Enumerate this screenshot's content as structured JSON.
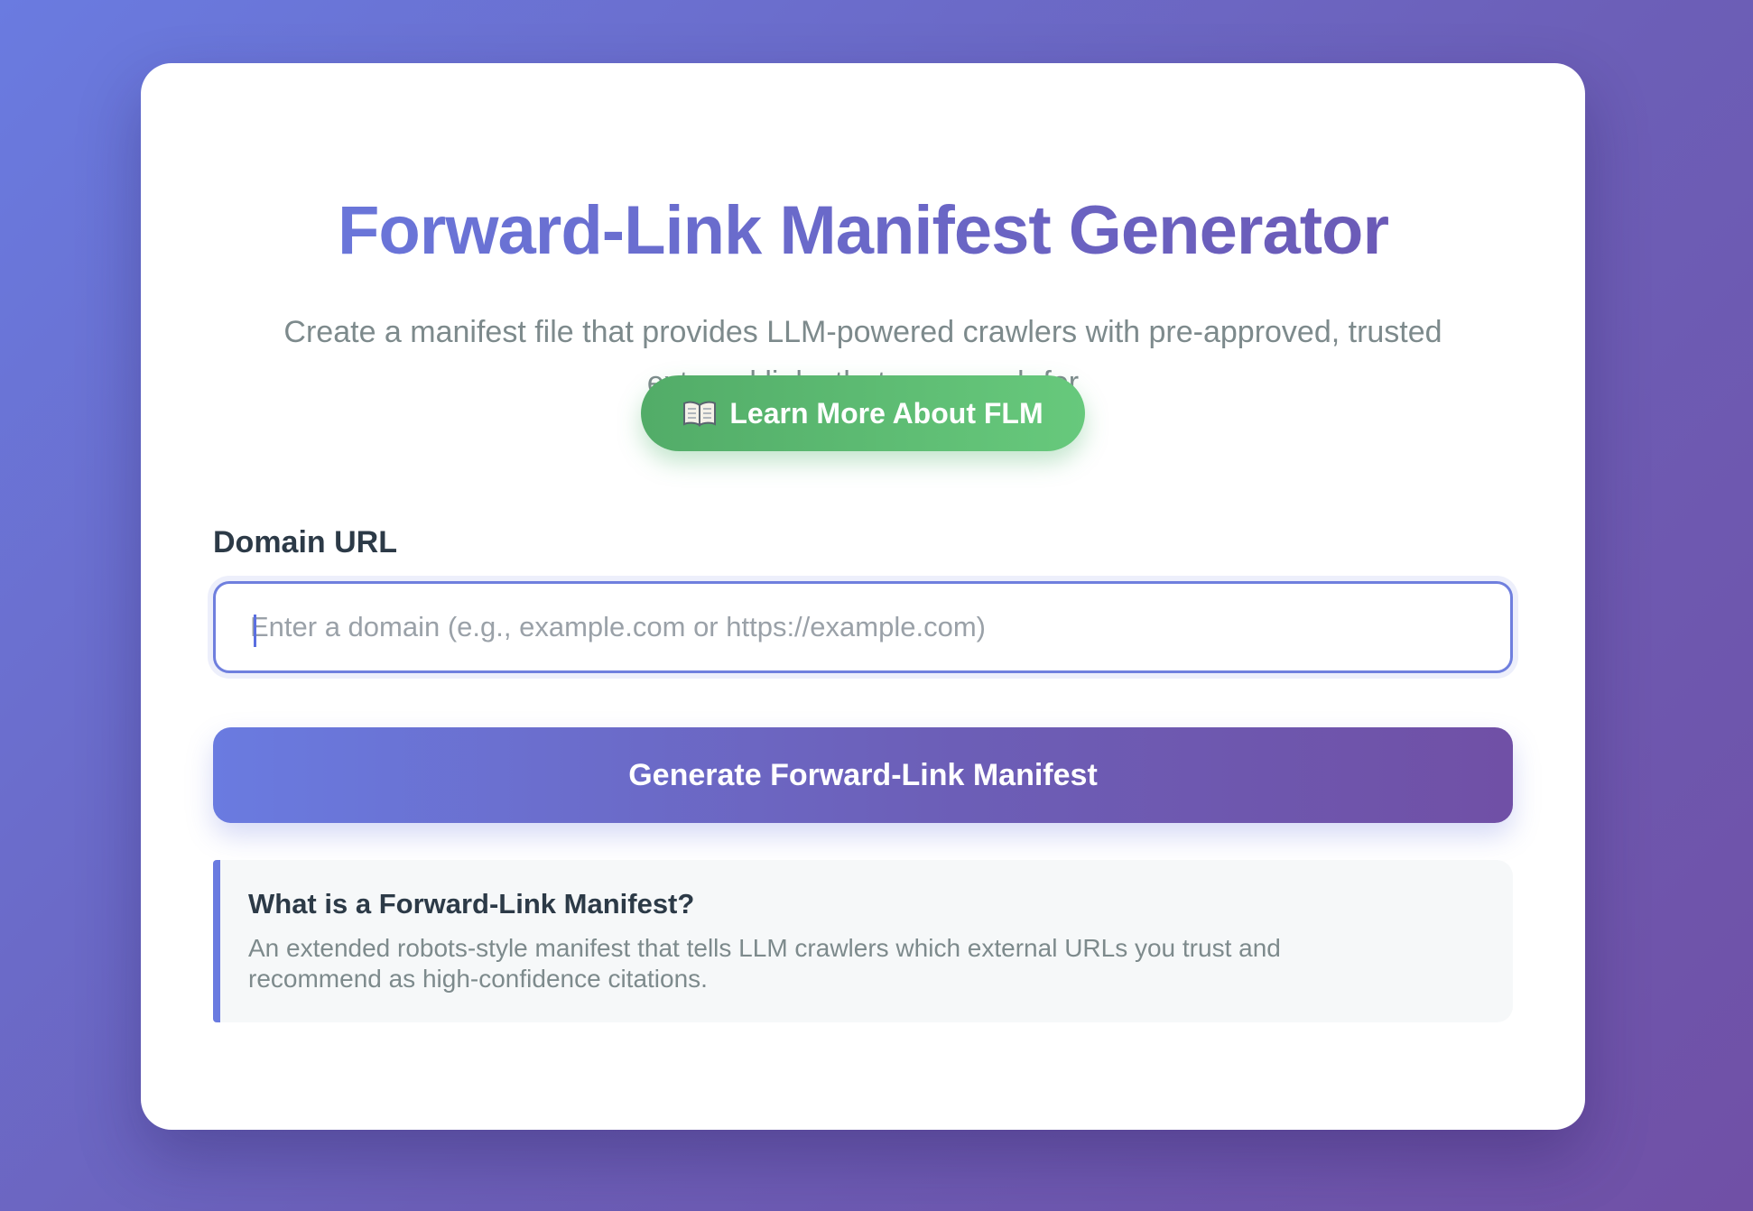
{
  "header": {
    "title": "Forward-Link Manifest Generator",
    "subtitle": "Create a manifest file that provides LLM-powered crawlers with pre-approved, trusted external links that you vouch for"
  },
  "learn_more": {
    "icon": "open-book-icon",
    "label": "Learn More About FLM"
  },
  "form": {
    "domain_label": "Domain URL",
    "domain_placeholder": "Enter a domain (e.g., example.com or https://example.com)",
    "domain_value": "",
    "generate_label": "Generate Forward-Link Manifest"
  },
  "info": {
    "title": "What is a Forward-Link Manifest?",
    "text": "An extended robots-style manifest that tells LLM crawlers which external URLs you trust and recommend as high-confidence citations."
  },
  "colors": {
    "accent_start": "#6a7be0",
    "accent_end": "#7050a6",
    "learn_button": "#5cb871",
    "muted_text": "#7d8a8c",
    "heading_text": "#2c3a47"
  }
}
